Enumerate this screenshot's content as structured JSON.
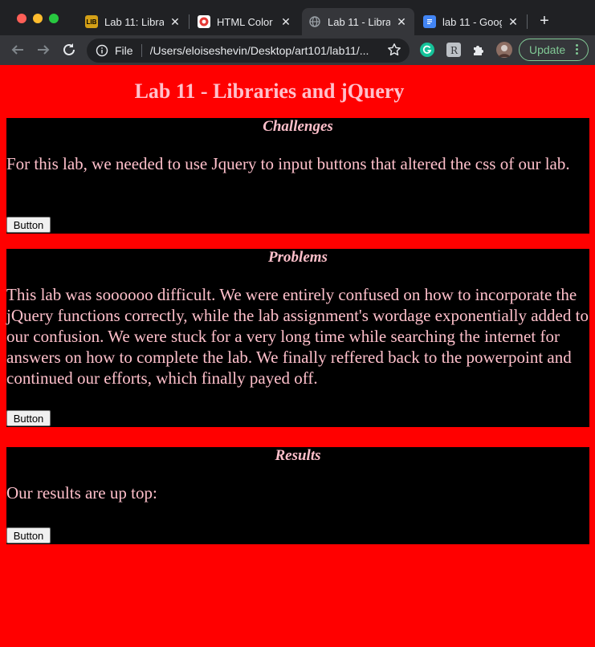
{
  "browser": {
    "tabs": [
      {
        "title": "Lab 11: Librar",
        "active": false
      },
      {
        "title": "HTML Color C",
        "active": false
      },
      {
        "title": "Lab 11 - Libra",
        "active": true
      },
      {
        "title": "lab 11 - Goog",
        "active": false
      }
    ],
    "omnibox": {
      "scheme_label": "File",
      "url": "/Users/eloiseshevin/Desktop/art101/lab11/..."
    },
    "update_label": "Update",
    "colors": {
      "frame": "#202124",
      "toolbar": "#35363a",
      "update_accent": "#81c995"
    }
  },
  "page": {
    "title": "Lab 11 - Libraries and jQuery",
    "colors": {
      "background": "#ff0000",
      "section_background": "#000000",
      "text": "#ffc0cb"
    },
    "sections": [
      {
        "heading": "Challenges",
        "body": "For this lab, we needed to use Jquery to input buttons that altered the css of our lab.",
        "button_label": "Button"
      },
      {
        "heading": "Problems",
        "body": "This lab was soooooo difficult. We were entirely confused on how to incorporate the jQuery functions correctly, while the lab assignment's wordage exponentially added to our confusion. We were stuck for a very long time while searching the internet for answers on how to complete the lab. We finally reffered back to the powerpoint and continued our efforts, which finally payed off.",
        "button_label": "Button"
      },
      {
        "heading": "Results",
        "body": "Our results are up top:",
        "button_label": "Button"
      }
    ]
  }
}
